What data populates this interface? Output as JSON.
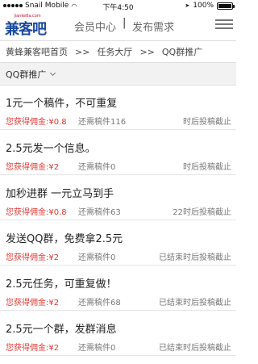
{
  "statusbar": {
    "carrier": "Snail Mobile",
    "time": "下午4:50",
    "battery": "100%",
    "battery_level": 1.0
  },
  "header": {
    "logo_small": "jianke8a.com",
    "logo_main": "兼客吧",
    "nav_member": "会员中心",
    "nav_separator": "|",
    "nav_publish": "发布需求"
  },
  "breadcrumb": {
    "items": [
      "黄蜂兼客吧首页",
      "任务大厅",
      "QQ群推广"
    ],
    "separator": ">>"
  },
  "filter": {
    "selected": "QQ群推广"
  },
  "tasks": [
    {
      "title": "1元一个稿件，不可重复",
      "reward_label": "您获得佣金:",
      "reward": "¥0.8",
      "remaining": "还需稿件116",
      "deadline": "时后投稿截止"
    },
    {
      "title": "2.5元发一个信息。",
      "reward_label": "您获得佣金:",
      "reward": "¥2",
      "remaining": "还需稿件0",
      "deadline": "时后投稿截止"
    },
    {
      "title": "加秒进群 一元立马到手",
      "reward_label": "您获得佣金:",
      "reward": "¥0.8",
      "remaining": "还需稿件63",
      "deadline": "22时后投稿截止"
    },
    {
      "title": "发送QQ群，免费拿2.5元",
      "reward_label": "您获得佣金:",
      "reward": "¥2",
      "remaining": "还需稿件0",
      "deadline": "已结束时后投稿截止"
    },
    {
      "title": "2.5元任务，可重复做！",
      "reward_label": "您获得佣金:",
      "reward": "¥2",
      "remaining": "还需稿件68",
      "deadline": "已结束时后投稿截止"
    },
    {
      "title": "2.5元一个群，发群消息",
      "reward_label": "您获得佣金:",
      "reward": "¥2",
      "remaining": "还需稿件0",
      "deadline": "已结束时后投稿截止"
    }
  ]
}
